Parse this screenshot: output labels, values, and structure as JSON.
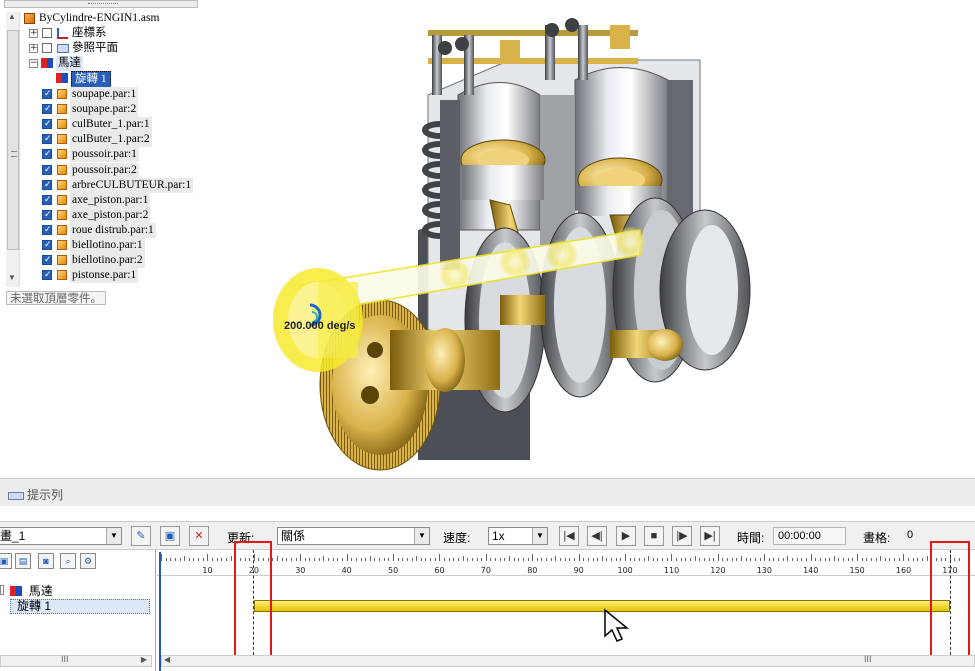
{
  "tree": {
    "root": "ByCylindre-ENGIN1.asm",
    "items": [
      {
        "label": "座標系",
        "expand": "+"
      },
      {
        "label": "參照平面",
        "expand": "+"
      },
      {
        "label": "馬達",
        "expand": "−"
      },
      {
        "label": "旋轉 1"
      }
    ],
    "parts": [
      "soupape.par:1",
      "soupape.par:2",
      "culButer_1.par:1",
      "culButer_1.par:2",
      "poussoir.par:1",
      "poussoir.par:2",
      "arbreCULBUTEUR.par:1",
      "axe_piston.par:1",
      "axe_piston.par:2",
      "roue distrub.par:1",
      "biellotino.par:1",
      "biellotino.par:2",
      "pistonse.par:1"
    ],
    "footer_hint": "未選取頂層零件。"
  },
  "viewport": {
    "speed_readout": "200.000 deg/s"
  },
  "hint_bar": {
    "title": "提示列"
  },
  "anim_toolbar": {
    "animation_name": "畫_1",
    "update_label": "更新:",
    "update_value": "關係",
    "speed_label": "速度:",
    "speed_value": "1x",
    "time_label": "時間:",
    "time_value": "00:00:00",
    "frame_label": "畫格:",
    "frame_value": "0",
    "buttons": {
      "first": "|◀",
      "prev": "◀|",
      "play": "▶",
      "stop": "■",
      "next": "|▶",
      "last": "▶|"
    }
  },
  "lower_left": {
    "motor_row": "馬達",
    "rotation_row": "旋轉 1",
    "scroll_grip": "III"
  },
  "timeline": {
    "ticks": [
      "10",
      "20",
      "30",
      "40",
      "50",
      "60",
      "70",
      "80",
      "90",
      "100",
      "110",
      "120",
      "130",
      "140",
      "150",
      "160",
      "170"
    ],
    "track_start": 20,
    "track_end": 170,
    "scroll_grip": "III",
    "marker_color": "#e01818",
    "track_color": "#f5d400"
  }
}
